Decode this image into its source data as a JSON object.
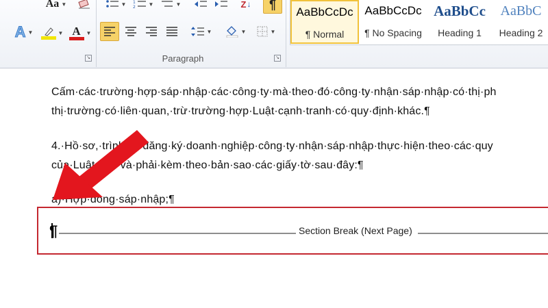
{
  "ribbon": {
    "font_group": {
      "font_size_glyph": "Aa",
      "text_effects_glyph": "A",
      "highlight_color": "#f2e600",
      "font_color_glyph": "A",
      "font_color": "#d81c1c"
    },
    "paragraph_group": {
      "label": "Paragraph",
      "sort_glyph": "Z",
      "show_marks_glyph": "¶"
    },
    "styles_gallery": [
      {
        "preview": "AaBbCcDc",
        "label": "¶ Normal",
        "selected": true,
        "preview_color": "#000000"
      },
      {
        "preview": "AaBbCcDc",
        "label": "¶ No Spacing",
        "selected": false,
        "preview_color": "#000000"
      },
      {
        "preview": "AaBbCc",
        "label": "Heading 1",
        "selected": false,
        "preview_color": "#1f4e8c"
      },
      {
        "preview": "AaBbC",
        "label": "Heading 2",
        "selected": false,
        "preview_color": "#4f81bd"
      }
    ]
  },
  "document": {
    "paragraphs": [
      "Cấm·các·trường·hợp·sáp·nhập·các·công·ty·mà·theo·đó·công·ty·nhận·sáp·nhập·có·thị·ph",
      "thị·trường·có·liên·quan,·trừ·trường·hợp·Luật·cạnh·tranh·có·quy·định·khác.¶",
      "4.·Hồ·sơ,·trình·tự·đăng·ký·doanh·nghiệp·công·ty·nhận·sáp·nhập·thực·hiện·theo·các·quy",
      "của·Luật·này·và·phải·kèm·theo·bản·sao·các·giấy·tờ·sau·đây:¶",
      "a)·Hợp·đồng·sáp·nhập;¶"
    ],
    "section_break": {
      "label": "Section Break (Next Page)",
      "pilcrow": "¶"
    }
  },
  "annotation": {
    "arrow_color": "#e3161e"
  }
}
